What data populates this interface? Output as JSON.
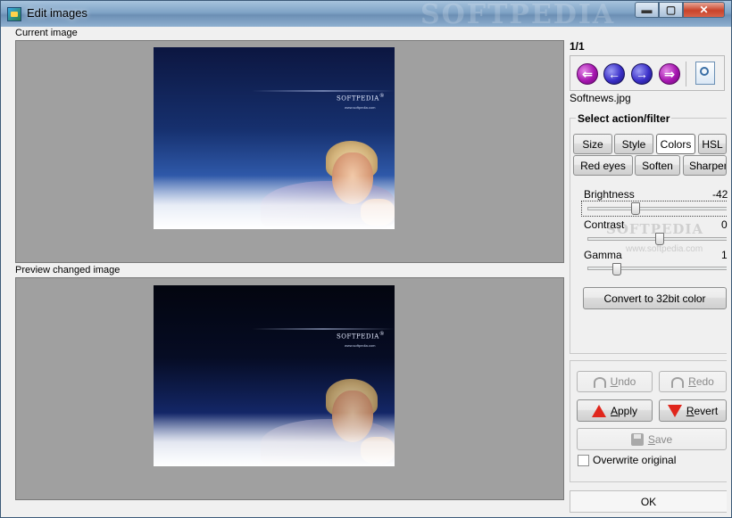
{
  "window": {
    "title": "Edit images",
    "title_watermark": "SOFTPEDIA",
    "controls": {
      "minimize": "▬",
      "maximize": "▢",
      "close": "✕"
    }
  },
  "left": {
    "current_label": "Current image",
    "preview_label": "Preview changed image",
    "image_brand": "SOFTPEDIA",
    "image_brand_mark": "®",
    "image_url": "www.softpedia.com"
  },
  "nav": {
    "counter": "1/1",
    "filename": "Softnews.jpg",
    "buttons": [
      "first",
      "previous",
      "next",
      "last"
    ],
    "icons": {
      "first": "⇐",
      "previous": "←",
      "next": "→",
      "last": "⇒"
    }
  },
  "filters": {
    "group_title": "Select action/filter",
    "tabs": [
      "Size",
      "Style",
      "Colors",
      "HSL"
    ],
    "tabs2": [
      "Red eyes",
      "Soften",
      "Sharpen"
    ],
    "active_tab": "Colors",
    "brightness": {
      "label": "Brightness",
      "value": "-42"
    },
    "contrast": {
      "label": "Contrast",
      "value": "0"
    },
    "gamma": {
      "label": "Gamma",
      "value": "1"
    },
    "convert_button": "Convert to 32bit color",
    "watermark": "SOFTPEDIA",
    "watermark_url": "www.softpedia.com"
  },
  "actions": {
    "undo": {
      "accel": "U",
      "rest": "ndo"
    },
    "redo": {
      "accel": "R",
      "rest": "edo"
    },
    "apply": {
      "accel": "A",
      "rest": "pply"
    },
    "revert": {
      "accel": "R",
      "rest": "evert"
    },
    "save": {
      "accel": "S",
      "rest": "ave"
    },
    "overwrite_label": "Overwrite original",
    "overwrite_checked": false
  },
  "ok_button": "OK",
  "colors": {
    "accent": "#e0261c",
    "pane_bg": "#a0a0a0",
    "arrow_magenta": "#a616b0",
    "arrow_blue": "#3a2fc8"
  }
}
